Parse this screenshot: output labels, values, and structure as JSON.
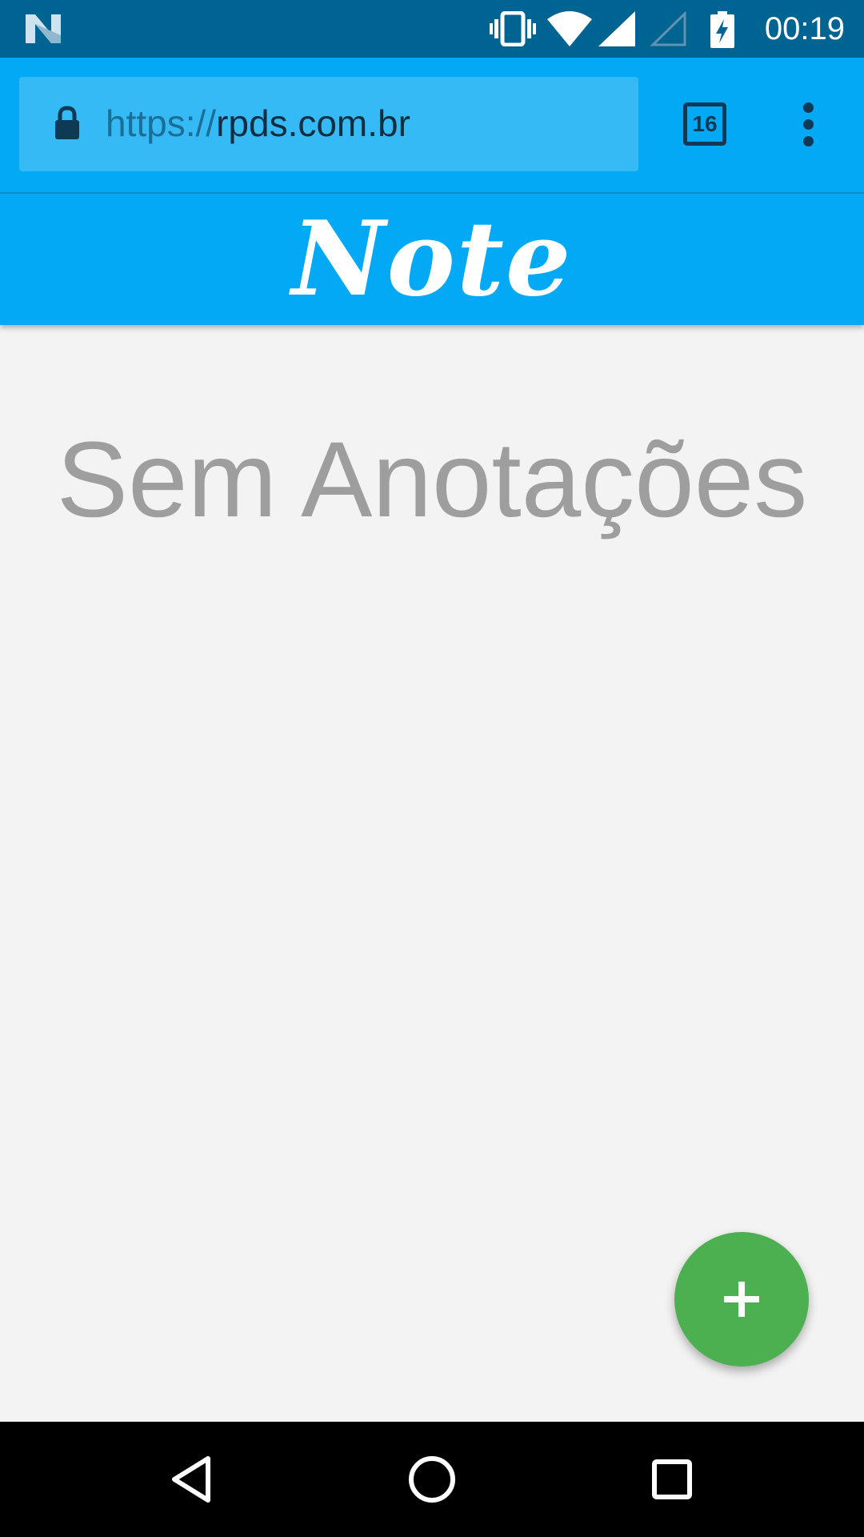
{
  "status_bar": {
    "time": "00:19",
    "icons": [
      "n-logo-icon",
      "vibrate-icon",
      "wifi-icon",
      "signal-icon",
      "signal-empty-icon",
      "battery-charging-icon"
    ]
  },
  "browser": {
    "url_scheme": "https://",
    "url_host": "rpds.com.br",
    "tab_count": "16",
    "icons": [
      "lock-icon",
      "tabs-icon",
      "more-vert-icon"
    ]
  },
  "app": {
    "logo_text": "Note",
    "empty_message": "Sem Anotações",
    "fab_icon": "plus-icon"
  },
  "nav_bar": {
    "icons": [
      "back-icon",
      "home-icon",
      "recents-icon"
    ]
  },
  "colors": {
    "status_bar": "#006492",
    "browser_bar": "#03a9f4",
    "fab": "#4caf50",
    "empty_text": "#9e9e9e",
    "background": "#f3f3f3"
  }
}
